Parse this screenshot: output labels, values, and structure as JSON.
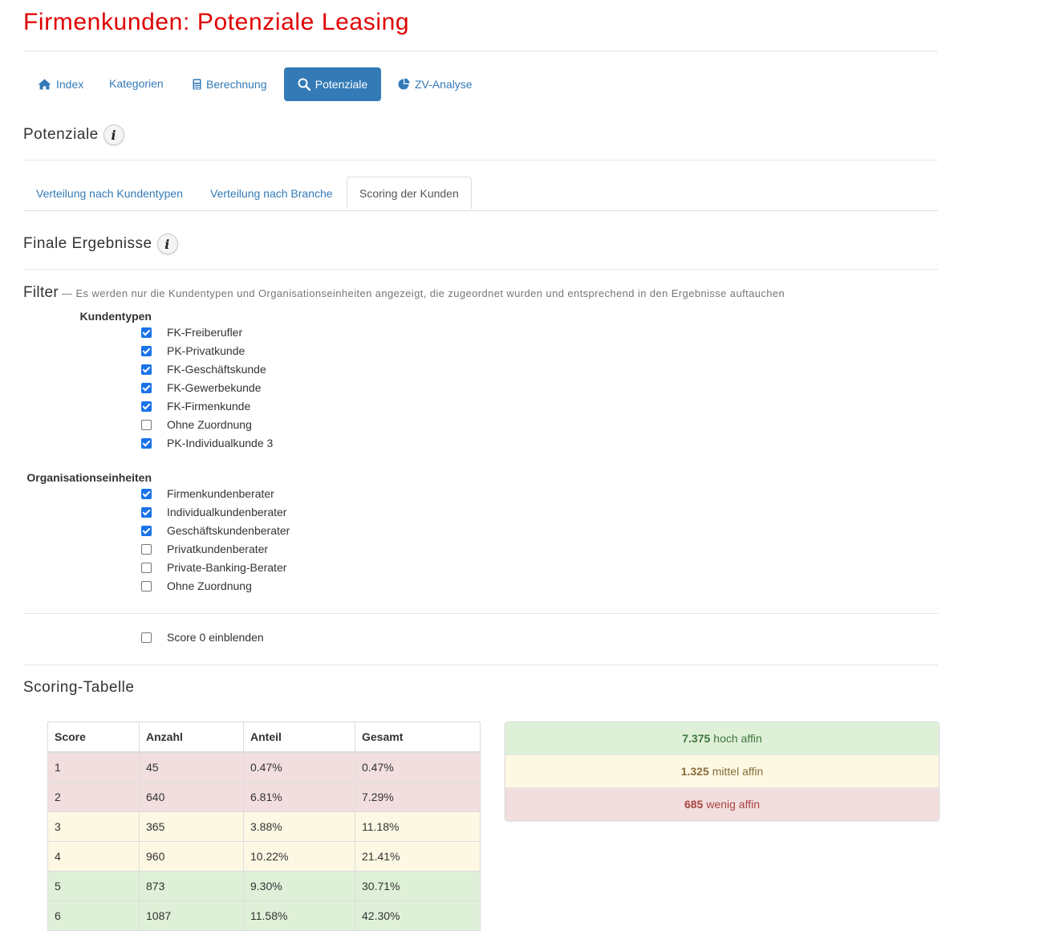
{
  "page": {
    "title": "Firmenkunden: Potenziale Leasing"
  },
  "nav": {
    "items": [
      {
        "label": "Index",
        "icon": "home-icon"
      },
      {
        "label": "Kategorien",
        "icon": ""
      },
      {
        "label": "Berechnung",
        "icon": "calculator-icon"
      },
      {
        "label": "Potenziale",
        "icon": "search-icon",
        "active": true
      },
      {
        "label": "ZV-Analyse",
        "icon": "pie-chart-icon"
      }
    ]
  },
  "section": {
    "title": "Potenziale"
  },
  "tabs": {
    "items": [
      {
        "label": "Verteilung nach Kundentypen"
      },
      {
        "label": "Verteilung nach Branche"
      },
      {
        "label": "Scoring der Kunden",
        "active": true
      }
    ]
  },
  "results": {
    "title": "Finale Ergebnisse"
  },
  "filter": {
    "title": "Filter",
    "note": "— Es werden nur die Kundentypen und Organisationseinheiten angezeigt, die zugeordnet wurden und entsprechend in den Ergebnisse auftauchen",
    "kundentypen": {
      "label": "Kundentypen",
      "items": [
        {
          "label": "FK-Freiberufler",
          "checked": true
        },
        {
          "label": "PK-Privatkunde",
          "checked": true
        },
        {
          "label": "FK-Geschäftskunde",
          "checked": true
        },
        {
          "label": "FK-Gewerbekunde",
          "checked": true
        },
        {
          "label": "FK-Firmenkunde",
          "checked": true
        },
        {
          "label": "Ohne Zuordnung",
          "checked": false
        },
        {
          "label": "PK-Individualkunde 3",
          "checked": true
        }
      ]
    },
    "org": {
      "label": "Organisationseinheiten",
      "items": [
        {
          "label": "Firmenkundenberater",
          "checked": true
        },
        {
          "label": "Individualkundenberater",
          "checked": true
        },
        {
          "label": "Geschäftskundenberater",
          "checked": true
        },
        {
          "label": "Privatkundenberater",
          "checked": false
        },
        {
          "label": "Private-Banking-Berater",
          "checked": false
        },
        {
          "label": "Ohne Zuordnung",
          "checked": false
        }
      ]
    },
    "score0": {
      "label": "Score 0 einblenden",
      "checked": false
    }
  },
  "scoring": {
    "title": "Scoring-Tabelle",
    "headers": [
      "Score",
      "Anzahl",
      "Anteil",
      "Gesamt"
    ],
    "rows": [
      {
        "cells": [
          "1",
          "45",
          "0.47%",
          "0.47%"
        ],
        "status": "danger"
      },
      {
        "cells": [
          "2",
          "640",
          "6.81%",
          "7.29%"
        ],
        "status": "danger"
      },
      {
        "cells": [
          "3",
          "365",
          "3.88%",
          "11.18%"
        ],
        "status": "warning"
      },
      {
        "cells": [
          "4",
          "960",
          "10.22%",
          "21.41%"
        ],
        "status": "warning"
      },
      {
        "cells": [
          "5",
          "873",
          "9.30%",
          "30.71%"
        ],
        "status": "success"
      },
      {
        "cells": [
          "6",
          "1087",
          "11.58%",
          "42.30%"
        ],
        "status": "success"
      }
    ],
    "summary": [
      {
        "value": "7.375",
        "label": "hoch affin",
        "status": "success"
      },
      {
        "value": "1.325",
        "label": "mittel affin",
        "status": "warning"
      },
      {
        "value": "685",
        "label": "wenig affin",
        "status": "danger"
      }
    ]
  },
  "colors": {
    "title": "#e00000",
    "link": "#337ab7",
    "active_pill": "#337ab7",
    "danger_bg": "#f2dede",
    "warning_bg": "#fcf8e3",
    "success_bg": "#dff0d8",
    "success_text": "#3c763d",
    "warning_text": "#8a6d3b",
    "danger_text": "#a94442",
    "checkbox": "#1a73e8"
  }
}
